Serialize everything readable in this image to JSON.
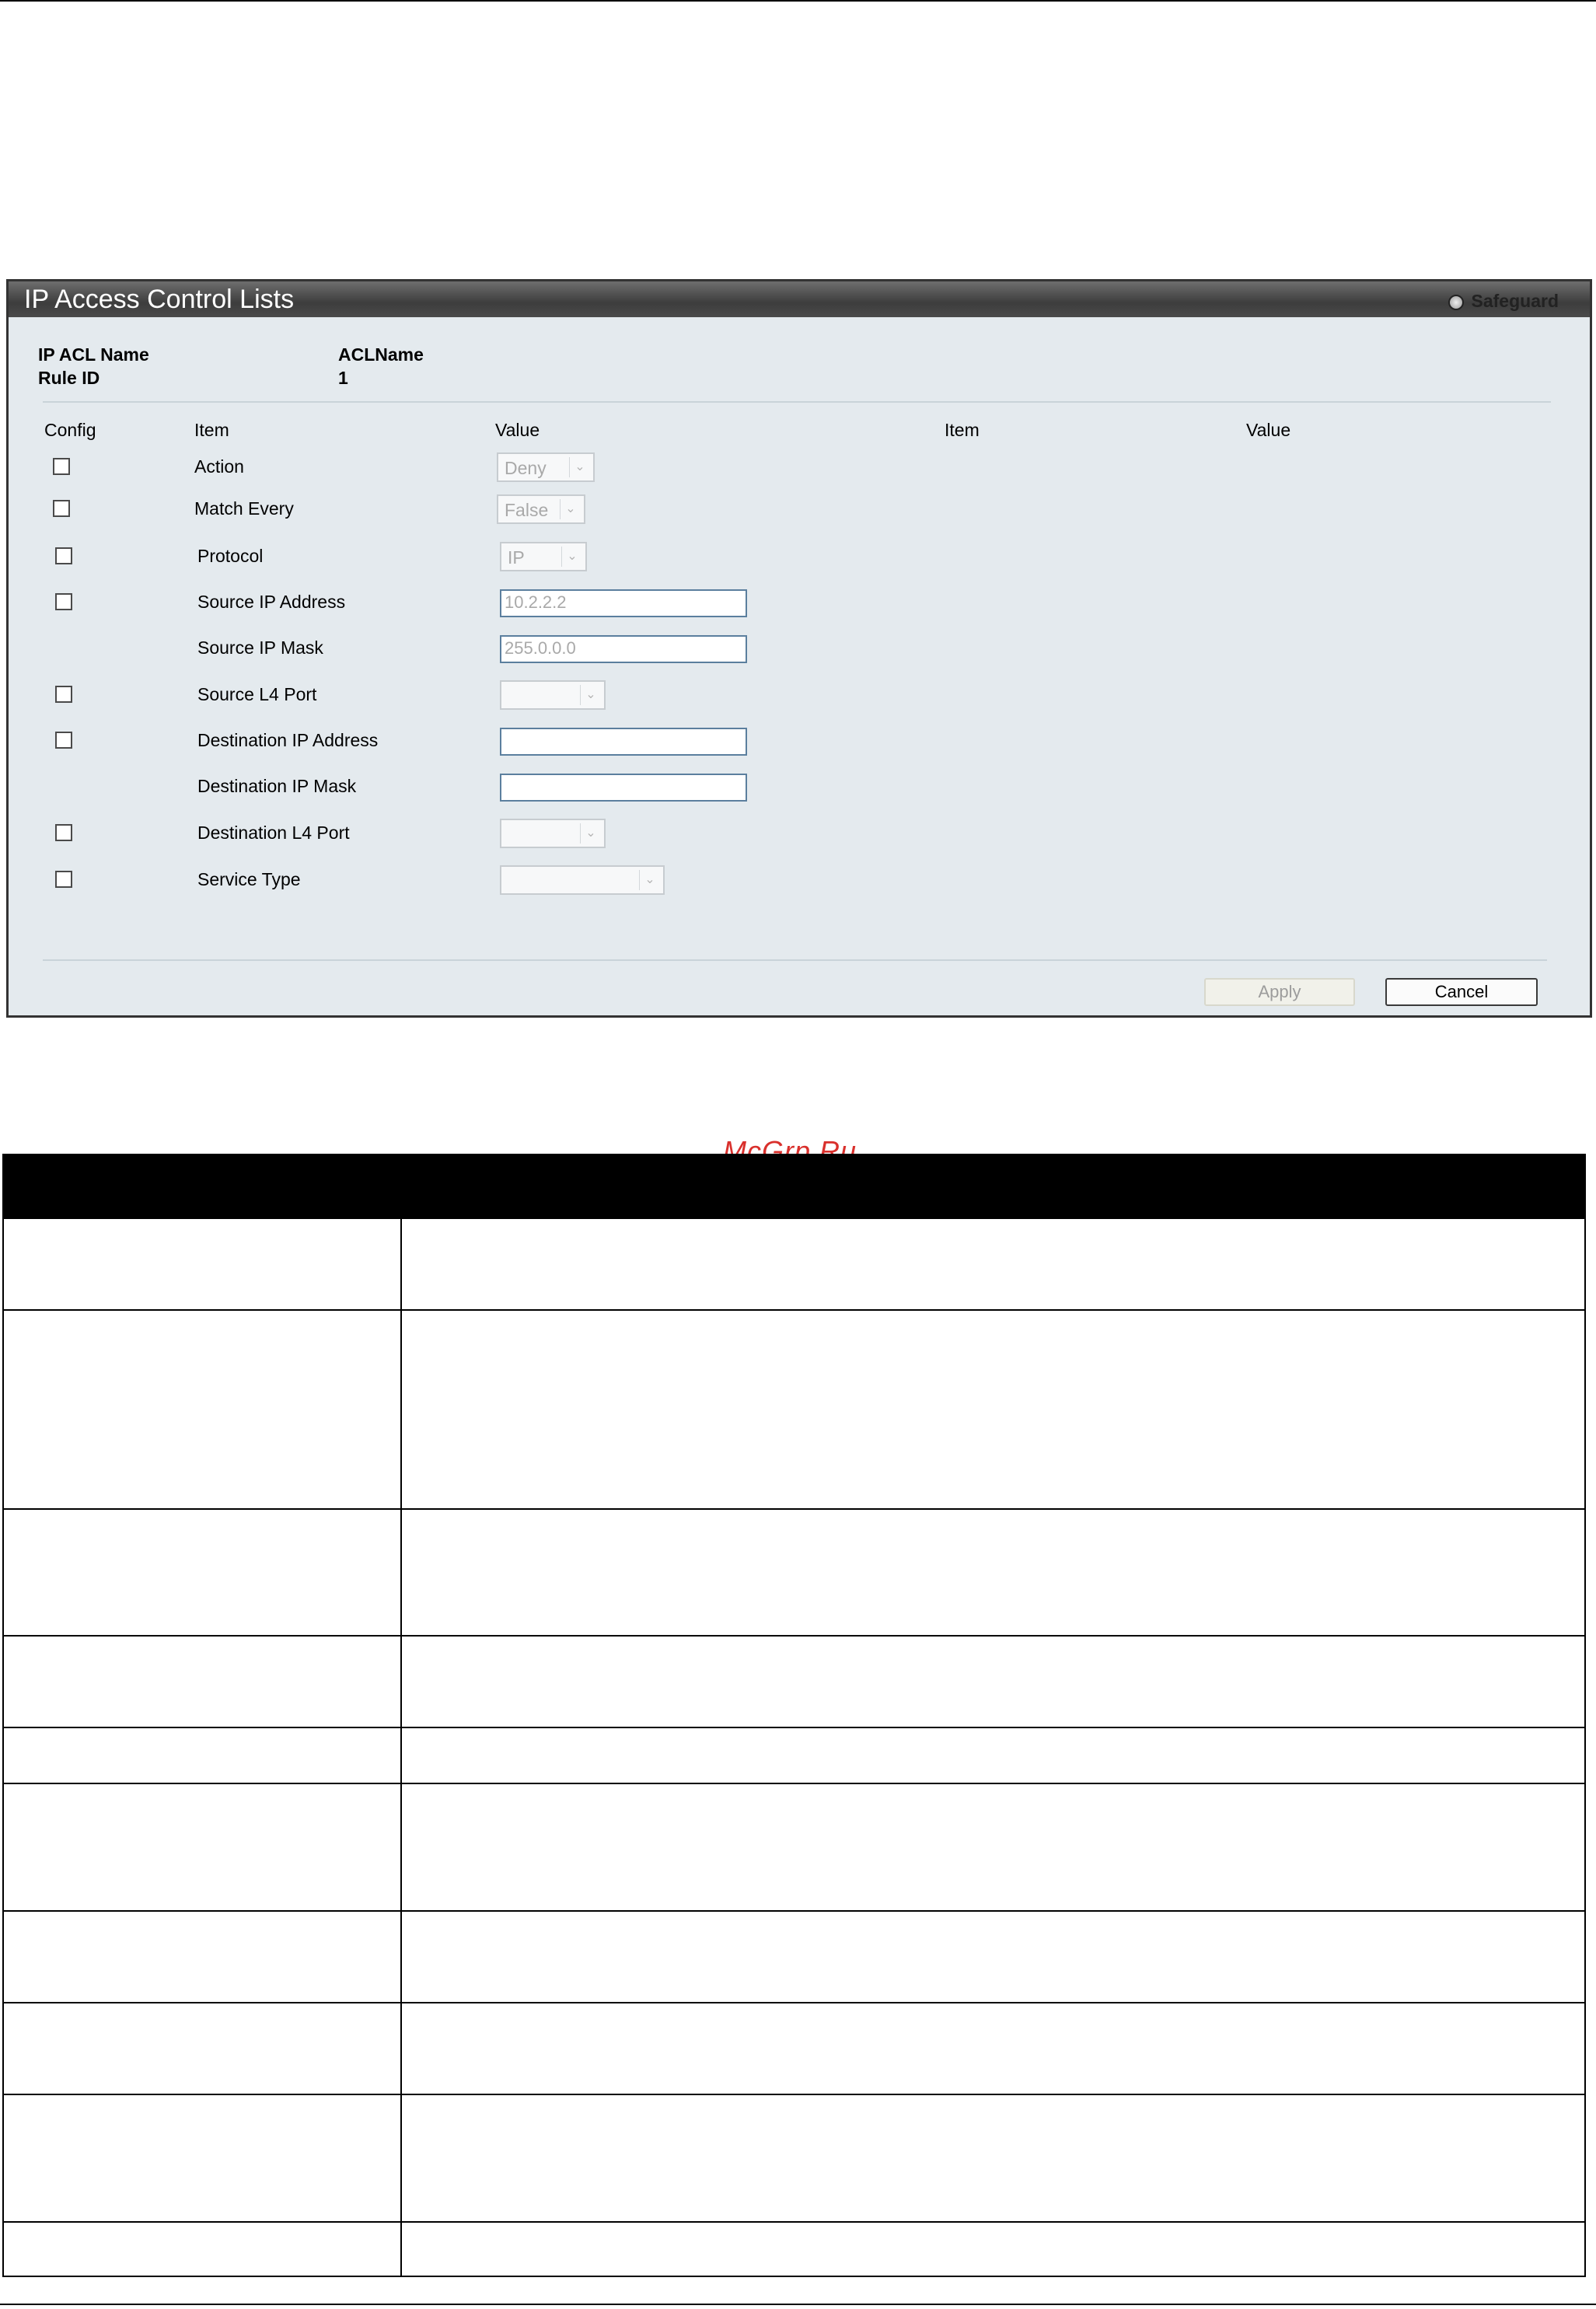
{
  "panel": {
    "title": "IP Access Control Lists",
    "safeguard_label": "Safeguard"
  },
  "info": {
    "acl_name_label": "IP ACL Name",
    "acl_name_value": "ACLName",
    "rule_id_label": "Rule ID",
    "rule_id_value": "1"
  },
  "columns": {
    "config": "Config",
    "item": "Item",
    "value": "Value",
    "item2": "Item",
    "value2": "Value"
  },
  "rows": {
    "action": {
      "label": "Action",
      "value": "Deny"
    },
    "match_every": {
      "label": "Match Every",
      "value": "False"
    },
    "protocol": {
      "label": "Protocol",
      "value": "IP"
    },
    "source_ip_address": {
      "label": "Source IP Address",
      "value": "10.2.2.2"
    },
    "source_ip_mask": {
      "label": "Source IP Mask",
      "value": "255.0.0.0"
    },
    "source_l4_port": {
      "label": "Source L4 Port",
      "value": ""
    },
    "destination_ip_address": {
      "label": "Destination IP Address",
      "value": ""
    },
    "destination_ip_mask": {
      "label": "Destination IP Mask",
      "value": ""
    },
    "destination_l4_port": {
      "label": "Destination L4 Port",
      "value": ""
    },
    "service_type": {
      "label": "Service Type",
      "value": ""
    }
  },
  "buttons": {
    "apply": "Apply",
    "cancel": "Cancel"
  },
  "watermark": "McGrp.Ru"
}
